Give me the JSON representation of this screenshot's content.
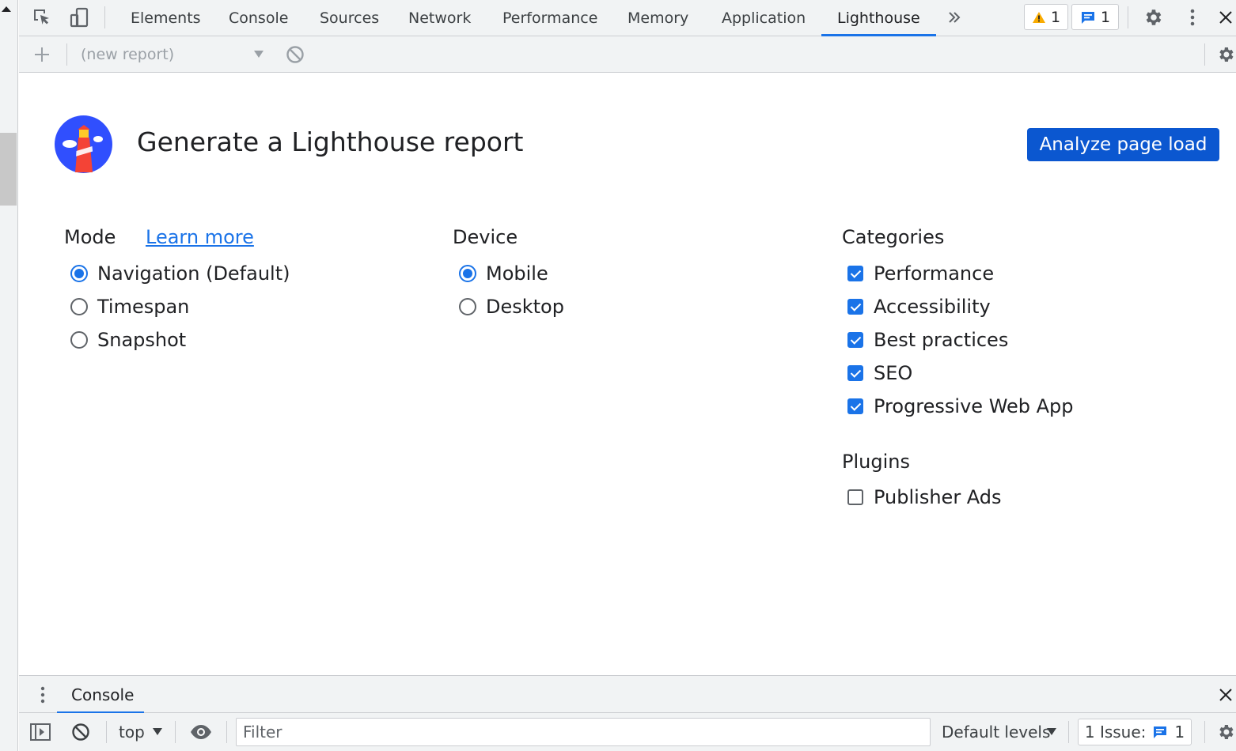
{
  "toolbar": {
    "tabs": [
      {
        "label": "Elements"
      },
      {
        "label": "Console"
      },
      {
        "label": "Sources"
      },
      {
        "label": "Network"
      },
      {
        "label": "Performance"
      },
      {
        "label": "Memory"
      },
      {
        "label": "Application"
      },
      {
        "label": "Lighthouse",
        "active": true
      }
    ],
    "warnings_count": "1",
    "messages_count": "1"
  },
  "lighthouse_bar": {
    "report_select": "(new report)"
  },
  "main": {
    "title": "Generate a Lighthouse report",
    "analyze_button": "Analyze page load",
    "mode": {
      "heading": "Mode",
      "learn_more": "Learn more",
      "options": [
        {
          "label": "Navigation (Default)",
          "selected": true
        },
        {
          "label": "Timespan",
          "selected": false
        },
        {
          "label": "Snapshot",
          "selected": false
        }
      ]
    },
    "device": {
      "heading": "Device",
      "options": [
        {
          "label": "Mobile",
          "selected": true
        },
        {
          "label": "Desktop",
          "selected": false
        }
      ]
    },
    "categories": {
      "heading": "Categories",
      "items": [
        {
          "label": "Performance",
          "checked": true
        },
        {
          "label": "Accessibility",
          "checked": true
        },
        {
          "label": "Best practices",
          "checked": true
        },
        {
          "label": "SEO",
          "checked": true
        },
        {
          "label": "Progressive Web App",
          "checked": true
        }
      ]
    },
    "plugins": {
      "heading": "Plugins",
      "items": [
        {
          "label": "Publisher Ads",
          "checked": false
        }
      ]
    }
  },
  "drawer": {
    "tab": "Console",
    "context": "top",
    "filter_placeholder": "Filter",
    "levels": "Default levels",
    "issues_label": "1 Issue:",
    "issues_count": "1"
  },
  "colors": {
    "accent": "#1a73e8",
    "button": "#0b57d0",
    "warning": "#f9ab00"
  }
}
